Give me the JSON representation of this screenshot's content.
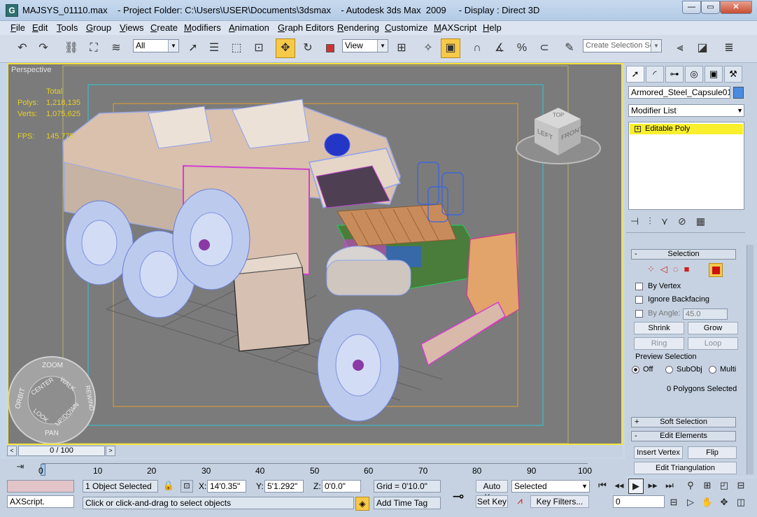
{
  "window": {
    "title": "MAJSYS_01110.max    - Project Folder: C:\\Users\\USER\\Documents\\3dsmax    - Autodesk 3ds Max  2009     - Display : Direct 3D",
    "app_icon_letter": "G",
    "minimize": "—",
    "maximize": "▭",
    "close": "✕"
  },
  "menu": [
    "File",
    "Edit",
    "Tools",
    "Group",
    "Views",
    "Create",
    "Modifiers",
    "Animation",
    "Graph Editors",
    "Rendering",
    "Customize",
    "MAXScript",
    "Help"
  ],
  "toolbar": {
    "filter_select": "All",
    "ref_coord_select": "View",
    "named_selection": "Create Selection Set"
  },
  "viewport": {
    "label": "Perspective",
    "stats_header": "Total",
    "polys_label": "Polys:",
    "polys_value": "1,218,135",
    "verts_label": "Verts:",
    "verts_value": "1,075,625",
    "fps_label": "FPS:",
    "fps_value": "145.775",
    "viewcube_left": "LEFT",
    "viewcube_front": "FRONT",
    "viewcube_top": "TOP",
    "wheel": {
      "zoom": "ZOOM",
      "orbit": "ORBIT",
      "center": "CENTER",
      "walk": "WALK",
      "rewind": "REWIND",
      "look": "LOOK",
      "updown": "UP/DOWN",
      "pan": "PAN"
    }
  },
  "command_panel": {
    "object_name": "Armored_Steel_Capsule01",
    "object_color": "#4a8be0",
    "modifier_list": "Modifier List",
    "stack_item": "Editable Poly",
    "selection_rollout": "Selection",
    "by_vertex": "By Vertex",
    "ignore_backfacing": "Ignore Backfacing",
    "by_angle": "By Angle:",
    "angle_value": "45.0",
    "shrink": "Shrink",
    "grow": "Grow",
    "ring": "Ring",
    "loop": "Loop",
    "preview_selection": "Preview Selection",
    "preview_off": "Off",
    "preview_subobj": "SubObj",
    "preview_multi": "Multi",
    "selected_count": "0 Polygons Selected",
    "soft_selection_rollout": "Soft Selection",
    "edit_elements_rollout": "Edit Elements",
    "insert_vertex": "Insert Vertex",
    "flip": "Flip",
    "edit_triangulation": "Edit Triangulation"
  },
  "timeline": {
    "frame_display": "0 / 100",
    "ticks": [
      "0",
      "10",
      "20",
      "30",
      "40",
      "50",
      "60",
      "70",
      "80",
      "90",
      "100"
    ]
  },
  "status": {
    "maxscript_label": "AXScript.",
    "selection_info": "1 Object Selected",
    "prompt": "Click or click-and-drag to select objects",
    "x_label": "X:",
    "x_value": "14'0.35\"",
    "y_label": "Y:",
    "y_value": "5'1.292\"",
    "z_label": "Z:",
    "z_value": "0'0.0\"",
    "grid": "Grid = 0'10.0\"",
    "add_time_tag": "Add Time Tag",
    "auto_key": "Auto Key",
    "set_key": "Set Key",
    "key_mode_select": "Selected",
    "key_filters": "Key Filters...",
    "current_frame": "0"
  }
}
